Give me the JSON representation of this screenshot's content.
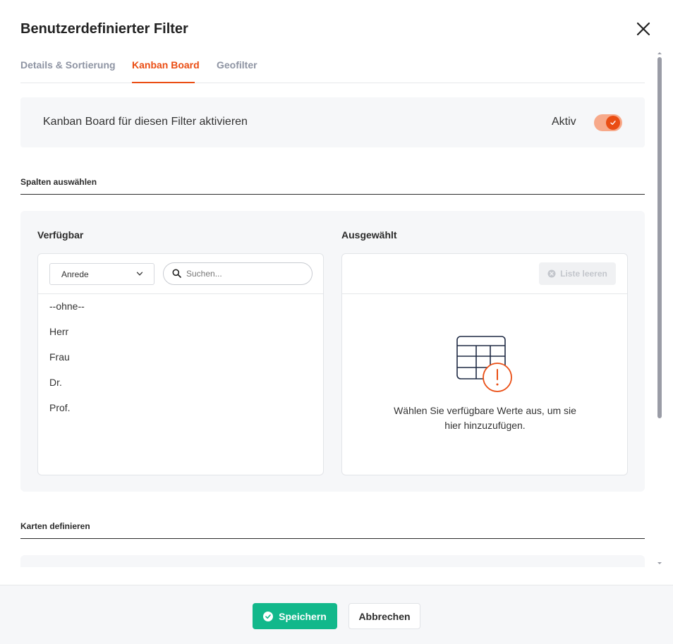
{
  "dialog": {
    "title": "Benutzerdefinierter Filter",
    "close_icon": "close-icon"
  },
  "tabs": [
    {
      "label": "Details & Sortierung",
      "active": false
    },
    {
      "label": "Kanban Board",
      "active": true
    },
    {
      "label": "Geofilter",
      "active": false
    }
  ],
  "kanban": {
    "label": "Kanban Board für diesen Filter aktivieren",
    "status_label": "Aktiv",
    "enabled": true
  },
  "columns_section": {
    "title": "Spalten auswählen",
    "available": {
      "heading": "Verfügbar",
      "field_select_value": "Anrede",
      "search_placeholder": "Suchen...",
      "items": [
        "--ohne--",
        "Herr",
        "Frau",
        "Dr.",
        "Prof."
      ]
    },
    "selected": {
      "heading": "Ausgewählt",
      "clear_label": "Liste leeren",
      "empty_text_line1": "Wählen Sie verfügbare Werte aus, um sie",
      "empty_text_line2": "hier hinzuzufügen."
    }
  },
  "cards_section": {
    "title": "Karten definieren"
  },
  "footer": {
    "save_label": "Speichern",
    "cancel_label": "Abbrechen"
  },
  "colors": {
    "accent": "#ea4d13",
    "success": "#12b88b",
    "muted": "#8e94a3"
  }
}
